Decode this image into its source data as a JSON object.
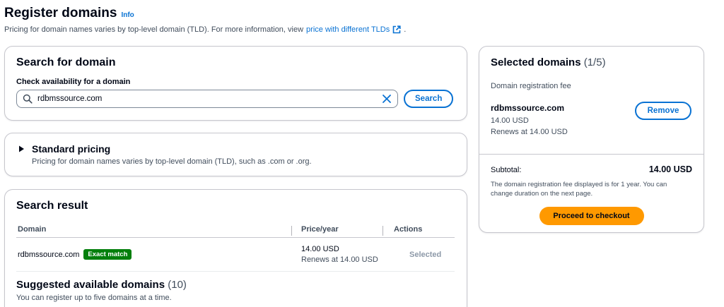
{
  "header": {
    "title": "Register domains",
    "info_link": "Info",
    "description": "Pricing for domain names varies by top-level domain (TLD). For more information, view",
    "price_link": "price with different TLDs",
    "trailing_period": "."
  },
  "search": {
    "title": "Search for domain",
    "field_label": "Check availability for a domain",
    "value": "rdbmssource.com",
    "button_label": "Search"
  },
  "pricing": {
    "title": "Standard pricing",
    "description": "Pricing for domain names varies by top-level domain (TLD), such as .com or .org."
  },
  "results": {
    "title": "Search result",
    "columns": [
      "Domain",
      "Price/year",
      "Actions"
    ],
    "rows": [
      {
        "domain": "rdbmssource.com",
        "badge": "Exact match",
        "price": "14.00 USD",
        "renewal": "Renews at 14.00 USD",
        "action": "Selected"
      }
    ]
  },
  "suggested": {
    "title": "Suggested available domains",
    "count": "(10)",
    "description": "You can register up to five domains at a time."
  },
  "selected": {
    "title": "Selected domains",
    "count": "(1/5)",
    "fee_label": "Domain registration fee",
    "item": {
      "name": "rdbmssource.com",
      "price": "14.00 USD",
      "renewal": "Renews at 14.00 USD",
      "remove_label": "Remove"
    },
    "subtotal_label": "Subtotal:",
    "subtotal_value": "14.00 USD",
    "note": "The domain registration fee displayed is for 1 year. You can change duration on the next page.",
    "checkout_label": "Proceed to checkout"
  },
  "colors": {
    "link": "#0972d3",
    "badge": "#037f0c",
    "primary_button": "#ff9900"
  },
  "icons": {
    "external": "external-link-icon",
    "search": "search-icon",
    "clear": "close-icon",
    "caret": "caret-right-icon"
  }
}
